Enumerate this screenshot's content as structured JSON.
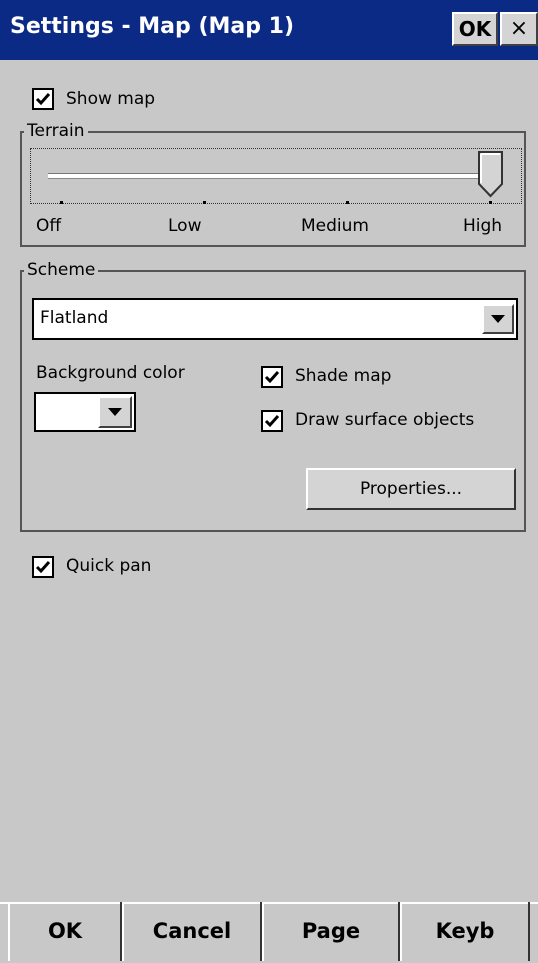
{
  "window": {
    "title": "Settings - Map (Map 1)",
    "ok_label": "OK",
    "close_label": "×"
  },
  "show_map": {
    "label": "Show map",
    "checked": true
  },
  "terrain": {
    "group_label": "Terrain",
    "level": "High",
    "ticks": [
      "Off",
      "Low",
      "Medium",
      "High"
    ]
  },
  "scheme": {
    "group_label": "Scheme",
    "selected": "Flatland",
    "background_color_label": "Background color",
    "background_color": "#ffffff",
    "shade_map": {
      "label": "Shade map",
      "checked": true
    },
    "draw_surface_objects": {
      "label": "Draw surface objects",
      "checked": true
    },
    "properties_label": "Properties..."
  },
  "quick_pan": {
    "label": "Quick pan",
    "checked": true
  },
  "softkeys": [
    "OK",
    "Cancel",
    "Page",
    "Keyb"
  ],
  "colors": {
    "titlebar": "#0a2a86",
    "background": "#c8c8c8"
  }
}
